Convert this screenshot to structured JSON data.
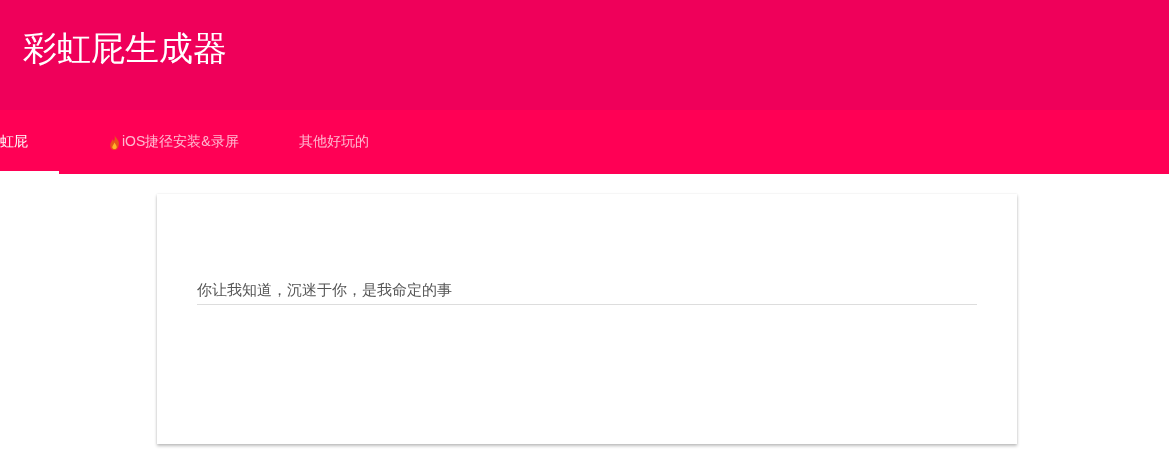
{
  "header": {
    "title": "彩虹屁生成器"
  },
  "tabs": [
    {
      "label": "虹屁",
      "selected": true,
      "icon": false
    },
    {
      "label": "iOS捷径安装&录屏",
      "selected": false,
      "icon": true
    },
    {
      "label": "其他好玩的",
      "selected": false,
      "icon": false
    }
  ],
  "card": {
    "field": {
      "value": "你让我知道，沉迷于你，是我命定的事"
    }
  }
}
